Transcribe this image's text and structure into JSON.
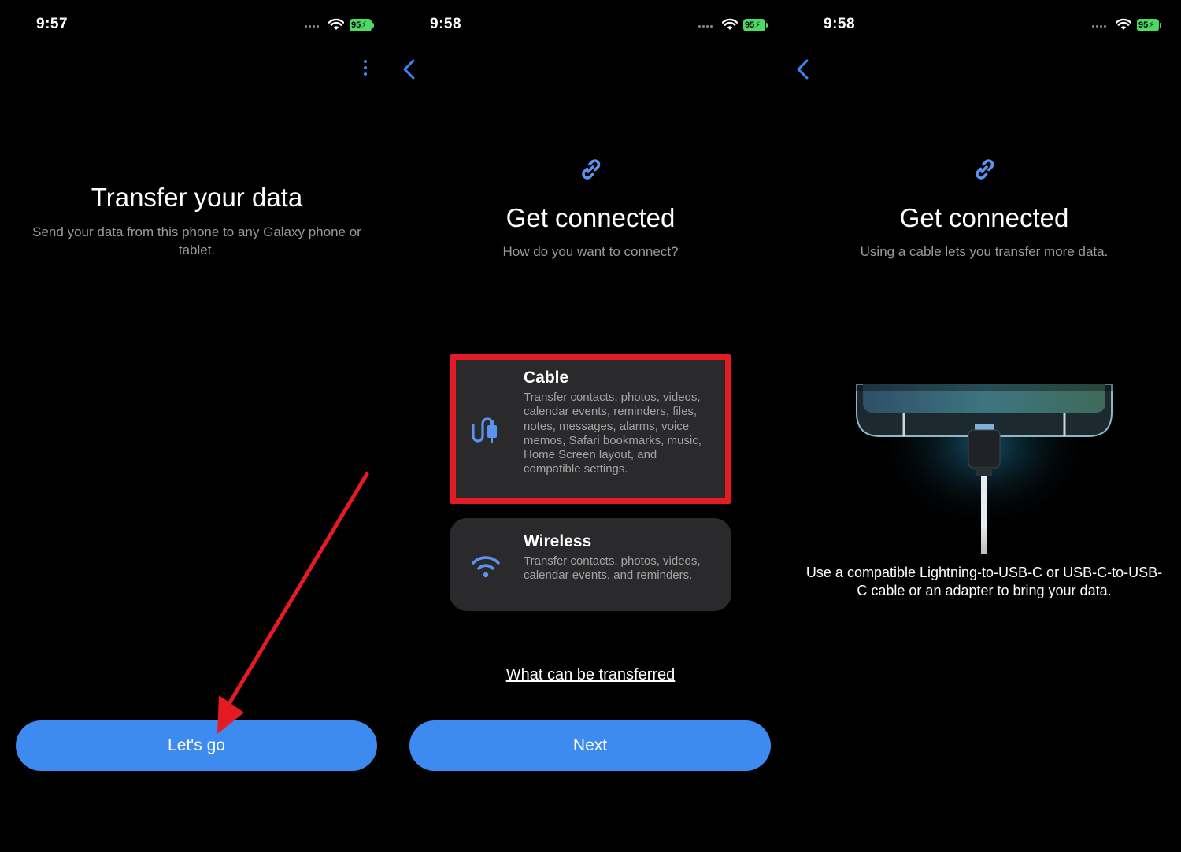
{
  "screens": [
    {
      "status": {
        "time": "9:57",
        "battery": "95"
      },
      "title": "Transfer your data",
      "subtitle": "Send your data from this phone to any Galaxy phone or tablet.",
      "button_label": "Let's go",
      "icons": {
        "menu": "more-vertical-icon"
      }
    },
    {
      "status": {
        "time": "9:58",
        "battery": "95"
      },
      "title": "Get connected",
      "subtitle": "How do you want to connect?",
      "options": [
        {
          "title": "Cable",
          "description": "Transfer contacts, photos, videos, calendar events, reminders, files, notes, messages, alarms, voice memos, Safari bookmarks, music, Home Screen layout, and compatible settings.",
          "icon": "cable-icon",
          "highlighted": true
        },
        {
          "title": "Wireless",
          "description": "Transfer contacts, photos, videos, calendar events, and reminders.",
          "icon": "wifi-icon",
          "highlighted": false
        }
      ],
      "link_text": "What can be transferred",
      "button_label": "Next"
    },
    {
      "status": {
        "time": "9:58",
        "battery": "95"
      },
      "title": "Get connected",
      "subtitle": "Using a cable lets you transfer more data.",
      "instruction": "Use a compatible Lightning-to-USB-C or USB-C-to-USB-C cable or an adapter to bring your data."
    }
  ],
  "colors": {
    "accent": "#3d8af0",
    "annotation_red": "#e41b23",
    "card_bg": "#2a2a2d",
    "battery_green": "#4cd964"
  }
}
